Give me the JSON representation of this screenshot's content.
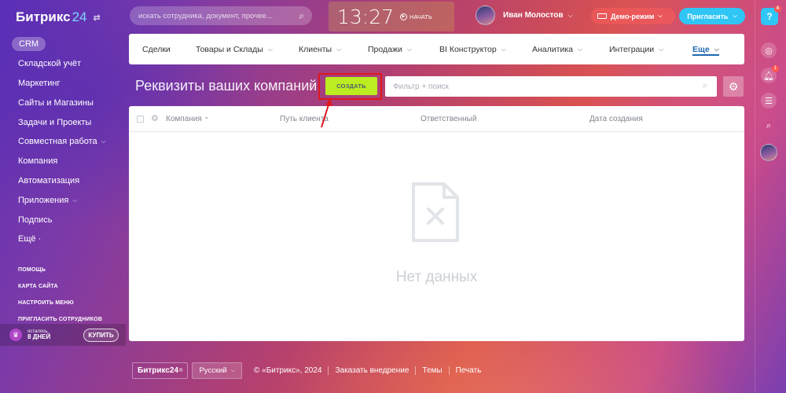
{
  "logo": {
    "name": "Битрикс",
    "num": "24",
    "pin": "⇄"
  },
  "sidebar": {
    "items": [
      {
        "label": "CRM",
        "active": true
      },
      {
        "label": "Складской учёт"
      },
      {
        "label": "Маркетинг"
      },
      {
        "label": "Сайты и Магазины"
      },
      {
        "label": "Задачи и Проекты"
      },
      {
        "label": "Совместная работа",
        "chevron": "⌵"
      },
      {
        "label": "Компания"
      },
      {
        "label": "Автоматизация"
      },
      {
        "label": "Приложения",
        "chevron": "⌵"
      },
      {
        "label": "Подпись"
      },
      {
        "label": "Ещё ·"
      }
    ],
    "small_links": [
      "ПОМОЩЬ",
      "КАРТА САЙТА",
      "НАСТРОИТЬ МЕНЮ",
      "ПРИГЛАСИТЬ СОТРУДНИКОВ"
    ],
    "trial": {
      "line1": "осталось",
      "line2": "8 ДНЕЙ",
      "buy": "КУПИТЬ"
    }
  },
  "topbar": {
    "search_placeholder": "искать сотрудника, документ, прочее...",
    "time": "13:27",
    "start": "НАЧАТЬ",
    "user_name": "Иван Молостов",
    "demo": "Демо-режим",
    "invite": "Пригласить"
  },
  "rail": {
    "help_badge": "4",
    "bell_badge": "1"
  },
  "menu": {
    "items": [
      {
        "label": "Сделки"
      },
      {
        "label": "Товары и Склады",
        "chevron": "⌵"
      },
      {
        "label": "Клиенты",
        "chevron": "⌵"
      },
      {
        "label": "Продажи",
        "chevron": "⌵"
      },
      {
        "label": "BI Конструктор",
        "chevron": "⌵"
      },
      {
        "label": "Аналитика",
        "chevron": "⌵"
      },
      {
        "label": "Интеграции",
        "chevron": "⌵"
      },
      {
        "label": "Еще",
        "chevron": "⌵",
        "active": true
      }
    ]
  },
  "page": {
    "title": "Реквизиты ваших компаний",
    "create_button": "СОЗДАТЬ",
    "filter_placeholder": "Фильтр + поиск"
  },
  "grid": {
    "columns": [
      "Компания",
      "Путь клиента",
      "Ответственный",
      "Дата создания"
    ],
    "sort_indicator": "⌃",
    "empty_text": "Нет данных"
  },
  "footer": {
    "logo": "Битрикс24",
    "logo_mark": "®",
    "language": "Русский",
    "copyright": "© «Битрикс», 2024",
    "links": [
      "Заказать внедрение",
      "Темы",
      "Печать"
    ]
  },
  "colors": {
    "create_button": "#bbed21",
    "highlight": "#e0171f",
    "invite": "#2fc6f6",
    "active_menu": "#2067b0"
  }
}
